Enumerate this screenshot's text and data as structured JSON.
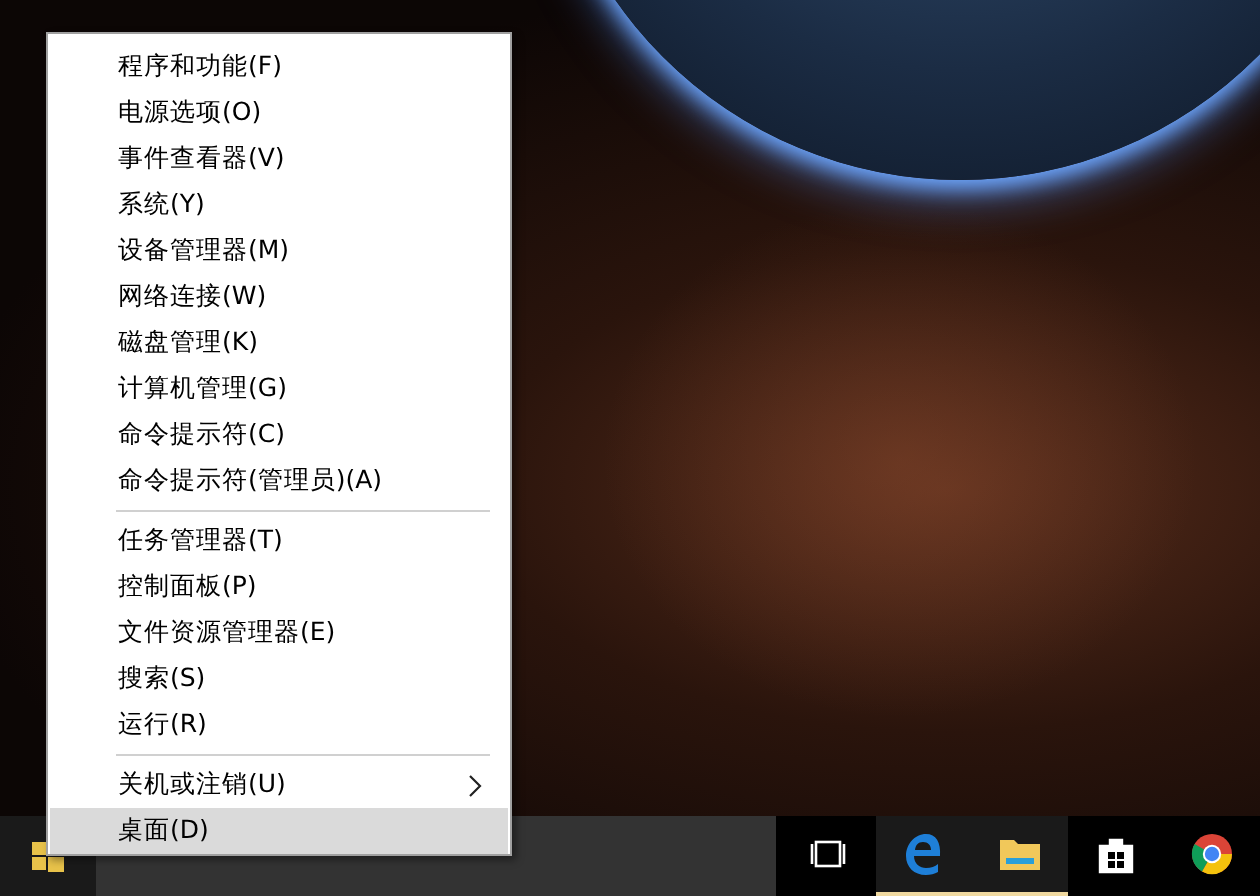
{
  "context_menu": {
    "groups": [
      [
        {
          "label": "程序和功能(F)",
          "selected": false,
          "submenu": false
        },
        {
          "label": "电源选项(O)",
          "selected": false,
          "submenu": false
        },
        {
          "label": "事件查看器(V)",
          "selected": false,
          "submenu": false
        },
        {
          "label": "系统(Y)",
          "selected": false,
          "submenu": false
        },
        {
          "label": "设备管理器(M)",
          "selected": false,
          "submenu": false
        },
        {
          "label": "网络连接(W)",
          "selected": false,
          "submenu": false
        },
        {
          "label": "磁盘管理(K)",
          "selected": false,
          "submenu": false
        },
        {
          "label": "计算机管理(G)",
          "selected": false,
          "submenu": false
        },
        {
          "label": "命令提示符(C)",
          "selected": false,
          "submenu": false
        },
        {
          "label": "命令提示符(管理员)(A)",
          "selected": false,
          "submenu": false
        }
      ],
      [
        {
          "label": "任务管理器(T)",
          "selected": false,
          "submenu": false
        },
        {
          "label": "控制面板(P)",
          "selected": false,
          "submenu": false
        },
        {
          "label": "文件资源管理器(E)",
          "selected": false,
          "submenu": false
        },
        {
          "label": "搜索(S)",
          "selected": false,
          "submenu": false
        },
        {
          "label": "运行(R)",
          "selected": false,
          "submenu": false
        }
      ],
      [
        {
          "label": "关机或注销(U)",
          "selected": false,
          "submenu": true
        },
        {
          "label": "桌面(D)",
          "selected": true,
          "submenu": false
        }
      ]
    ]
  },
  "taskbar": {
    "apps": [
      {
        "kind": "taskview",
        "running": false
      },
      {
        "kind": "edge",
        "running": true
      },
      {
        "kind": "explorer",
        "running": true
      },
      {
        "kind": "store",
        "running": false
      },
      {
        "kind": "chrome",
        "running": false
      }
    ]
  }
}
